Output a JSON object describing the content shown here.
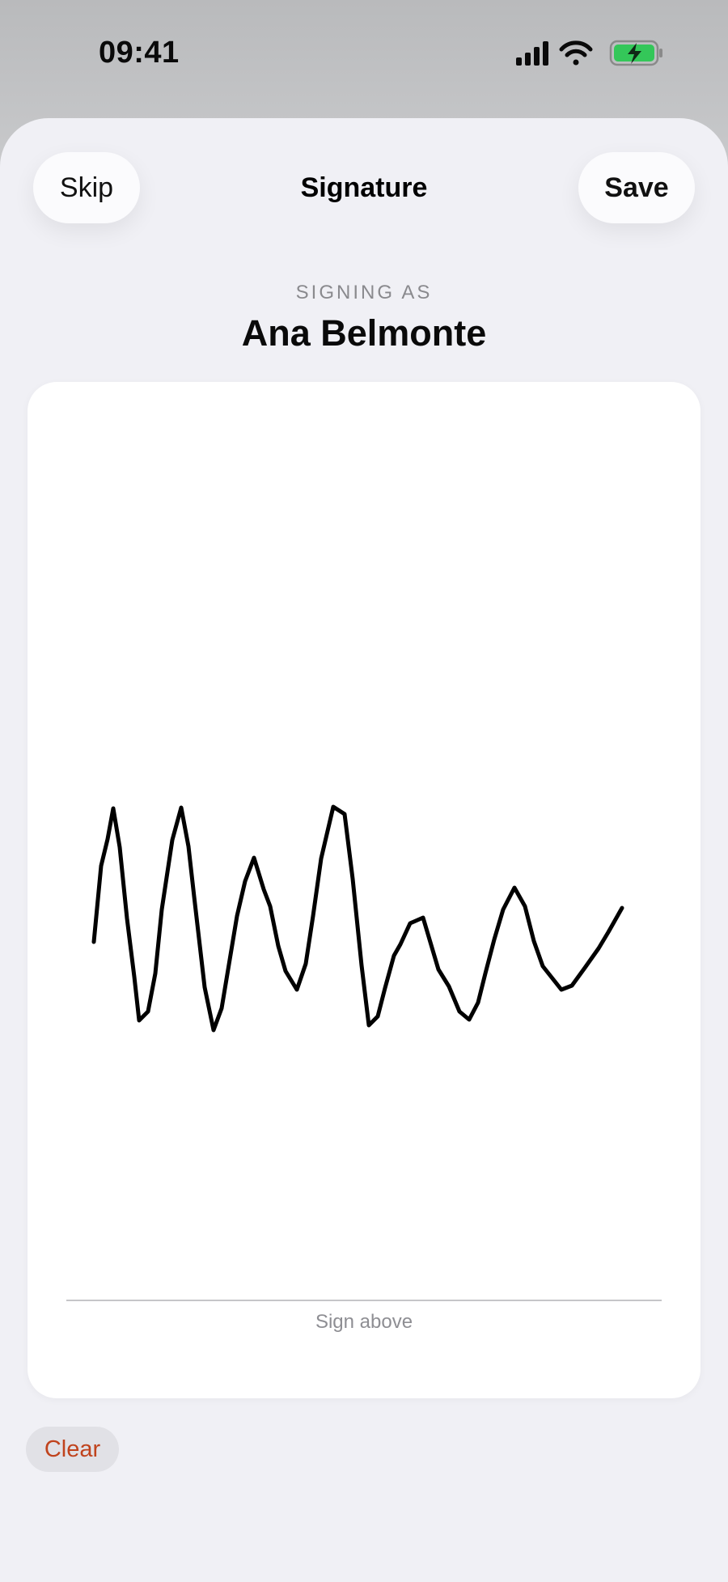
{
  "status_bar": {
    "time": "09:41",
    "icons": [
      "cellular-signal-icon",
      "wifi-icon",
      "battery-charging-icon"
    ],
    "battery_color": "#34c759"
  },
  "nav": {
    "skip_label": "Skip",
    "title": "Signature",
    "save_label": "Save"
  },
  "signer": {
    "caption": "SIGNING AS",
    "name": "Ana Belmonte"
  },
  "signature_pad": {
    "hint": "Sign above",
    "stroke_color": "#000000"
  },
  "actions": {
    "clear_label": "Clear",
    "clear_color": "#c0431d"
  }
}
